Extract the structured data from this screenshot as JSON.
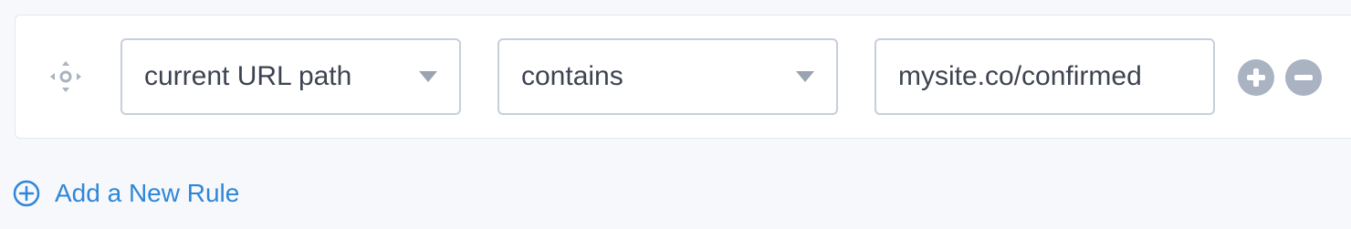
{
  "rule": {
    "condition_field": {
      "selected": "current URL path"
    },
    "operator_field": {
      "selected": "contains"
    },
    "value_field": {
      "value": "mysite.co/confirmed"
    }
  },
  "footer": {
    "add_rule_label": "Add a New Rule"
  },
  "colors": {
    "accent": "#2f86d8",
    "muted_button": "#a9b3c2",
    "field_border": "#c7cfdb",
    "text": "#3d4350"
  },
  "icons": {
    "drag": "drag-handle-icon",
    "add": "plus-circle-icon",
    "remove": "minus-circle-icon",
    "caret": "chevron-down-icon"
  }
}
